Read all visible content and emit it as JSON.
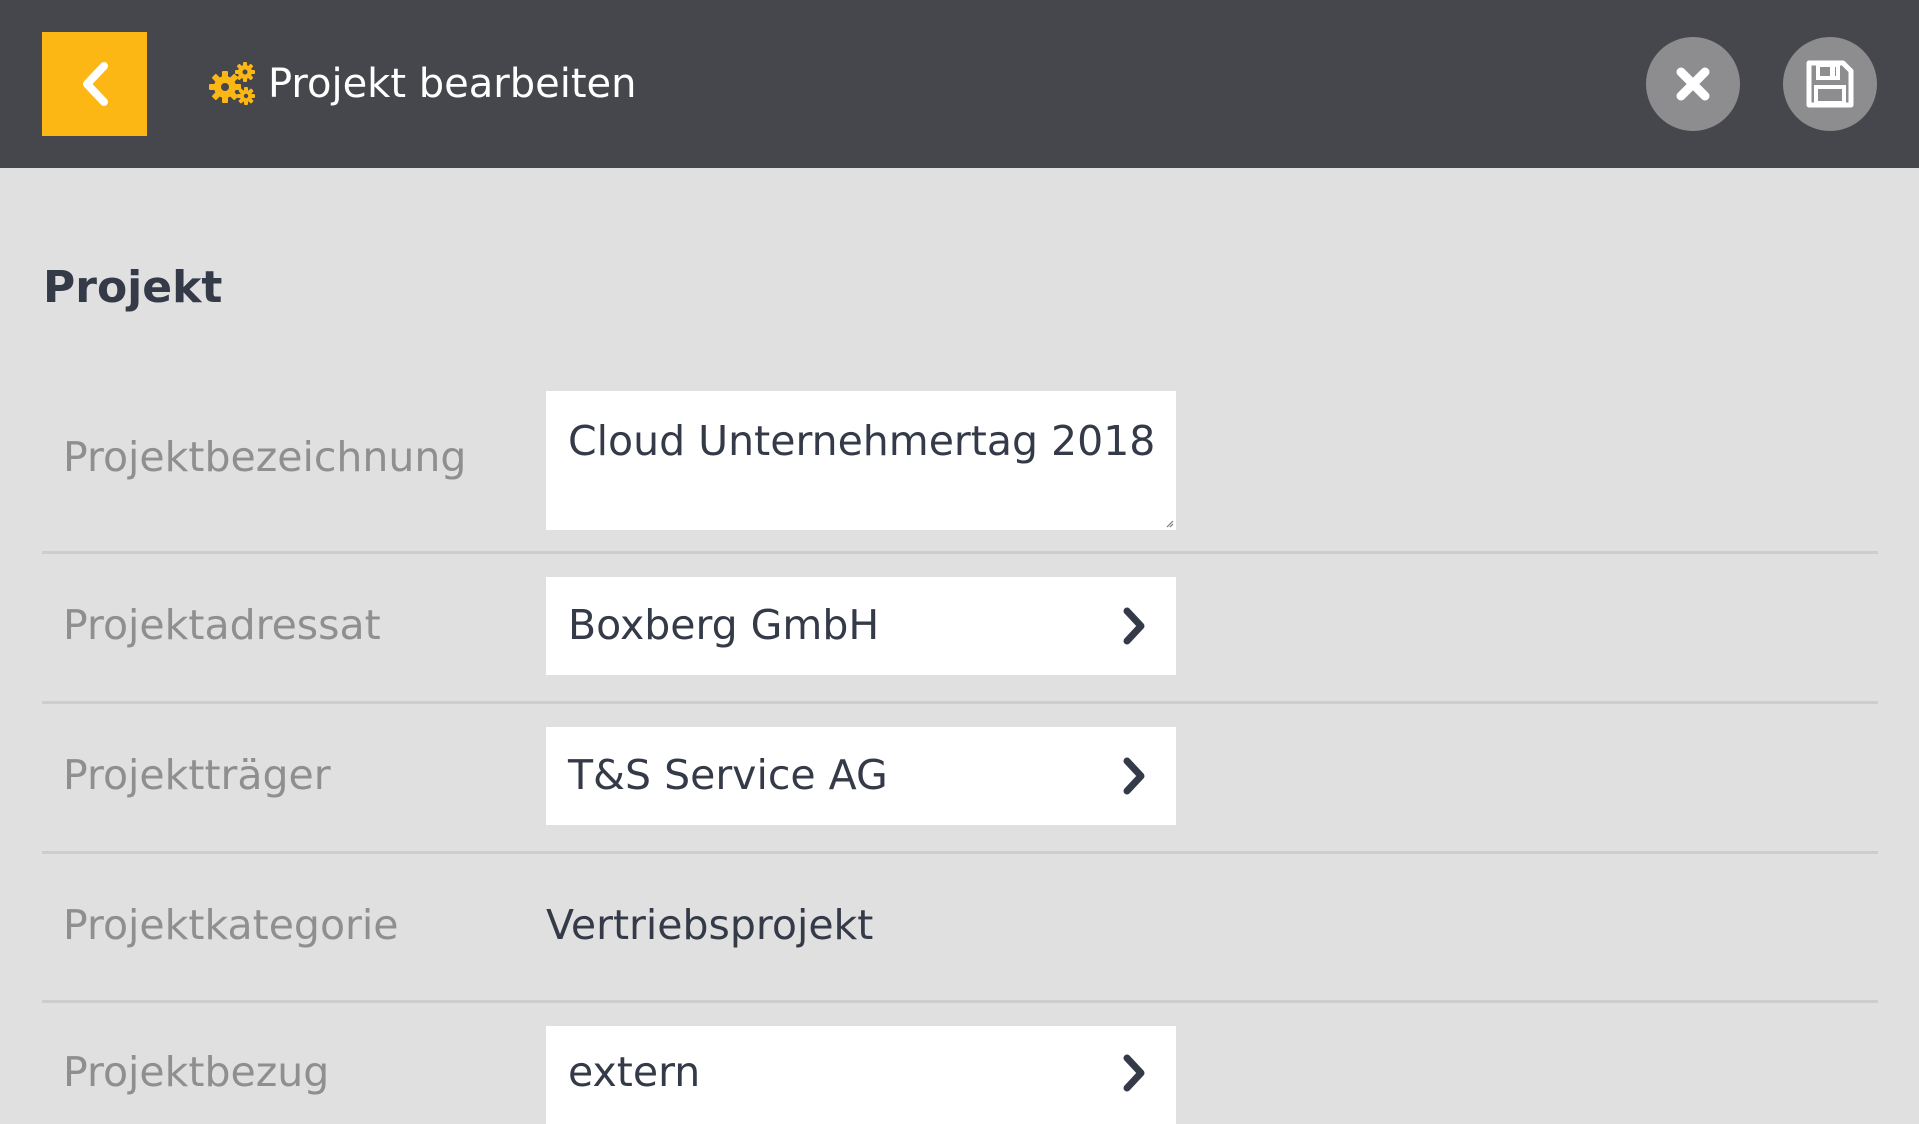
{
  "header": {
    "title": "Projekt bearbeiten",
    "back_icon": "chevron-left-icon",
    "title_icon": "gears-icon",
    "close_icon": "close-icon",
    "save_icon": "floppy-disk-icon",
    "accent_color": "#fdb714",
    "bar_color": "#46474c"
  },
  "section": {
    "title": "Projekt"
  },
  "fields": {
    "bezeichnung": {
      "label": "Projektbezeichnung",
      "value": "Cloud Unternehmertag 2018"
    },
    "adressat": {
      "label": "Projektadressat",
      "value": "Boxberg GmbH",
      "icon": "chevron-right-icon"
    },
    "traeger": {
      "label": "Projektträger",
      "value": "T&S Service AG",
      "icon": "chevron-right-icon"
    },
    "kategorie": {
      "label": "Projektkategorie",
      "value": "Vertriebsprojekt"
    },
    "bezug": {
      "label": "Projektbezug",
      "value": "extern",
      "icon": "chevron-right-icon"
    }
  }
}
